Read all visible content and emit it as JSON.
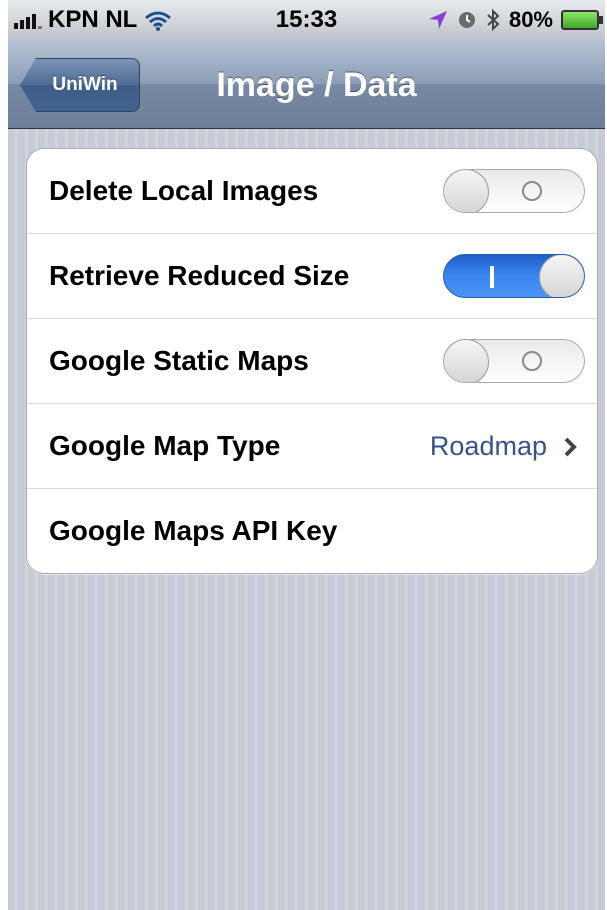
{
  "status_bar": {
    "carrier": "KPN NL",
    "time": "15:33",
    "battery_percent": "80%",
    "icons": [
      "signal-icon",
      "wifi-icon",
      "location-icon",
      "alarm-icon",
      "bluetooth-icon",
      "battery-charging-icon"
    ]
  },
  "nav": {
    "back_label": "UniWin",
    "title": "Image / Data"
  },
  "settings": {
    "rows": [
      {
        "label": "Delete Local Images",
        "type": "toggle",
        "on": false
      },
      {
        "label": "Retrieve Reduced Size",
        "type": "toggle",
        "on": true
      },
      {
        "label": "Google Static Maps",
        "type": "toggle",
        "on": false
      },
      {
        "label": "Google Map Type",
        "type": "disclosure",
        "value": "Roadmap"
      },
      {
        "label": "Google Maps API Key",
        "type": "text"
      }
    ]
  },
  "colors": {
    "nav_bar": "#8b9db5",
    "toggle_on": "#3a87f2",
    "detail_value": "#385487",
    "background": "#c7ccd6"
  }
}
